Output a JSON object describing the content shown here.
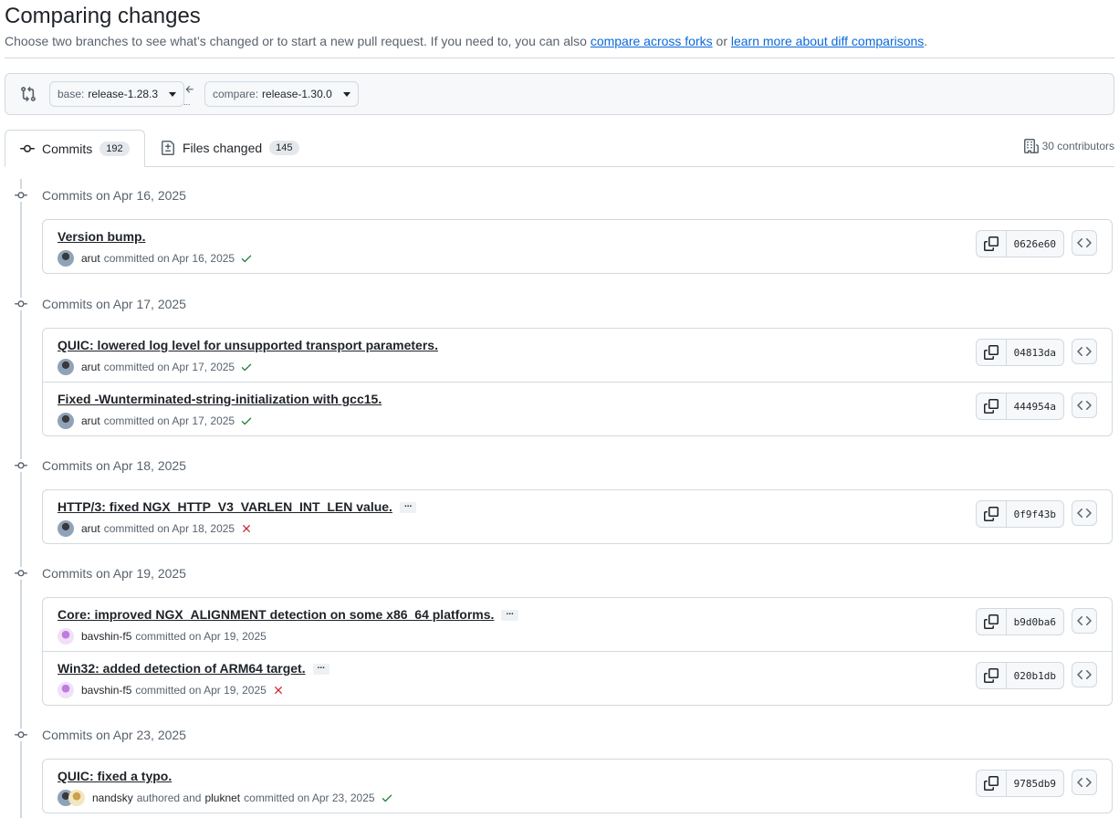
{
  "header": {
    "title": "Comparing changes",
    "subtitle_pre": "Choose two branches to see what’s changed or to start a new pull request. If you need to, you can also ",
    "link_forks": "compare across forks",
    "subtitle_mid": " or ",
    "link_learn": "learn more about diff comparisons",
    "subtitle_end": "."
  },
  "range": {
    "base_key": "base:",
    "base_value": "release-1.28.3",
    "compare_key": "compare:",
    "compare_value": "release-1.30.0",
    "arrow_dots": "..."
  },
  "tabs": {
    "commits_label": "Commits",
    "commits_count": "192",
    "files_label": "Files changed",
    "files_count": "145",
    "contributors": "30 contributors"
  },
  "commit_days": [
    {
      "date": "Commits on Apr 16, 2025",
      "commits": [
        {
          "message": "Version bump.",
          "author": "arut",
          "verb": "committed on Apr 16, 2025",
          "sha": "0626e60",
          "status": "success"
        }
      ]
    },
    {
      "date": "Commits on Apr 17, 2025",
      "commits": [
        {
          "message": "QUIC: lowered log level for unsupported transport parameters.",
          "author": "arut",
          "verb": "committed on Apr 17, 2025",
          "sha": "04813da",
          "status": "success"
        },
        {
          "message": "Fixed -Wunterminated-string-initialization with gcc15.",
          "author": "arut",
          "verb": "committed on Apr 17, 2025",
          "sha": "444954a",
          "status": "success"
        }
      ]
    },
    {
      "date": "Commits on Apr 18, 2025",
      "commits": [
        {
          "message": "HTTP/3: fixed NGX_HTTP_V3_VARLEN_INT_LEN value.",
          "author": "arut",
          "verb": "committed on Apr 18, 2025",
          "sha": "0f9f43b",
          "status": "failure",
          "more": "..."
        }
      ]
    },
    {
      "date": "Commits on Apr 19, 2025",
      "commits": [
        {
          "message": "Core: improved NGX_ALIGNMENT detection on some x86_64 platforms.",
          "author": "bavshin-f5",
          "verb": "committed on Apr 19, 2025",
          "sha": "b9d0ba6",
          "status": "none",
          "more": "..."
        },
        {
          "message": "Win32: added detection of ARM64 target.",
          "author": "bavshin-f5",
          "verb": "committed on Apr 19, 2025",
          "sha": "020b1db",
          "status": "failure",
          "more": "..."
        }
      ]
    },
    {
      "date": "Commits on Apr 23, 2025",
      "commits": [
        {
          "message": "QUIC: fixed a typo.",
          "author": "nandsky",
          "verb_mid": "authored and",
          "coauthor": "pluknet",
          "verb": "committed on Apr 23, 2025",
          "sha": "9785db9",
          "status": "success"
        }
      ]
    }
  ],
  "colors": {
    "success": "#1a7f37",
    "failure": "#d1242f",
    "link": "#0969da"
  },
  "icons": [
    "git-compare-icon",
    "arrow-left-icon",
    "git-commit-icon",
    "file-diff-icon",
    "organization-icon",
    "copy-icon",
    "code-icon",
    "check-icon",
    "x-icon"
  ]
}
